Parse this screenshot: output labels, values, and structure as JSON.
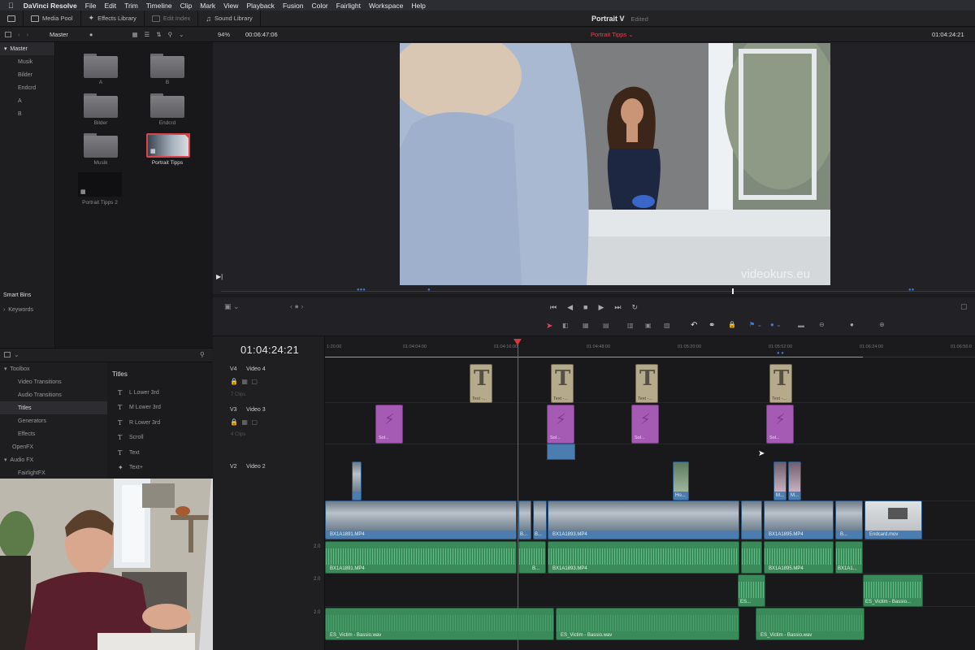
{
  "menubar": {
    "app": "DaVinci Resolve",
    "items": [
      "File",
      "Edit",
      "Trim",
      "Timeline",
      "Clip",
      "Mark",
      "View",
      "Playback",
      "Fusion",
      "Color",
      "Fairlight",
      "Workspace",
      "Help"
    ]
  },
  "toolbar": {
    "media_pool": "Media Pool",
    "effects_library": "Effects Library",
    "edit_index": "Edit Index",
    "sound_library": "Sound Library",
    "project_name": "Portrait V",
    "project_status": "Edited"
  },
  "media_pool": {
    "bin_title": "Master",
    "zoom": "94%",
    "source_tc": "00:06:47:06",
    "bins": [
      "Master",
      "Musik",
      "Bilder",
      "Endcrd",
      "A",
      "B"
    ],
    "smart_bins": "Smart Bins",
    "keywords": "Keywords",
    "clips": [
      {
        "label": "A"
      },
      {
        "label": "B"
      },
      {
        "label": "Bilder"
      },
      {
        "label": "Endcrd"
      },
      {
        "label": "Musik"
      },
      {
        "label": "Portrait Tipps"
      },
      {
        "label": "Portrait Tipps 2"
      }
    ]
  },
  "viewer": {
    "timeline_name": "Portrait Tipps",
    "record_tc": "01:04:24:21",
    "watermark": "videokurs.eu"
  },
  "effects": {
    "tree": [
      "Toolbox",
      "Video Transitions",
      "Audio Transitions",
      "Titles",
      "Generators",
      "Effects",
      "OpenFX",
      "Audio FX",
      "FairlightFX"
    ],
    "selected": "Titles",
    "list_header": "Titles",
    "list": [
      "L Lower 3rd",
      "M Lower 3rd",
      "R Lower 3rd",
      "Scroll",
      "Text",
      "Text+"
    ]
  },
  "timeline": {
    "timecode": "01:04:24:21",
    "ruler": [
      "1:20:00",
      "01:04:04:00",
      "01:04:16:00",
      "01:04:48:00",
      "01:05:20:00",
      "01:05:52:00",
      "01:06:24:00",
      "01:06:56:0"
    ],
    "tracks": [
      {
        "id": "V4",
        "name": "Video 4",
        "clips": "7 Clips"
      },
      {
        "id": "V3",
        "name": "Video 3",
        "clips": "4 Clips"
      },
      {
        "id": "V2",
        "name": "Video 2",
        "clips": ""
      }
    ],
    "text_clip_label": "Text -...",
    "gen_clip_label": "Sol...",
    "v2_labels": [
      "Ho...",
      "M...",
      "M..."
    ],
    "v1_labels": [
      "BX1A1891.MP4",
      "B...",
      "B...",
      "BX1A1893.MP4",
      "BX1A1895.MP4",
      "B...",
      "Endcard.mov"
    ],
    "a1_labels": [
      "BX1A1891.MP4",
      "B...",
      "BX1A1893.MP4",
      "BX1A1895.MP4",
      "BX1A1..."
    ],
    "a2_labels": [
      "ES...",
      "ES_Victim - Bassio..."
    ],
    "a3_labels": [
      "ES_Victim - Bassio.wav",
      "ES_Victim - Bassio.wav",
      "ES_Victim - Bassio.wav"
    ],
    "audio_gain": "2.0"
  }
}
